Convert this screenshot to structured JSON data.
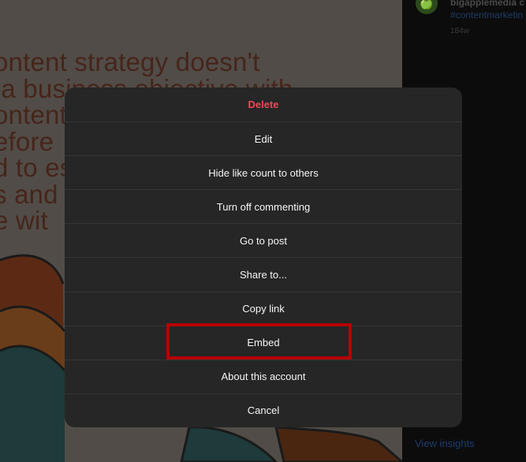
{
  "post": {
    "text_lines": [
      "ontent strategy doesn't",
      " a business objective with",
      "ontent",
      "efore",
      "d to es",
      "s and",
      "e wit"
    ]
  },
  "side_panel": {
    "avatar_icon": "apple-icon",
    "username": "bigapplemedia c",
    "hashtag": "#contentmarketin",
    "time_ago": "184w",
    "view_insights": "View insights"
  },
  "menu": {
    "items": [
      {
        "label": "Delete",
        "style": "danger"
      },
      {
        "label": "Edit"
      },
      {
        "label": "Hide like count to others"
      },
      {
        "label": "Turn off commenting"
      },
      {
        "label": "Go to post"
      },
      {
        "label": "Share to..."
      },
      {
        "label": "Copy link"
      },
      {
        "label": "Embed",
        "highlighted": true
      },
      {
        "label": "About this account"
      },
      {
        "label": "Cancel"
      }
    ]
  },
  "colors": {
    "danger": "#ed4956",
    "highlight": "#b80000",
    "modal_bg": "#262626"
  }
}
